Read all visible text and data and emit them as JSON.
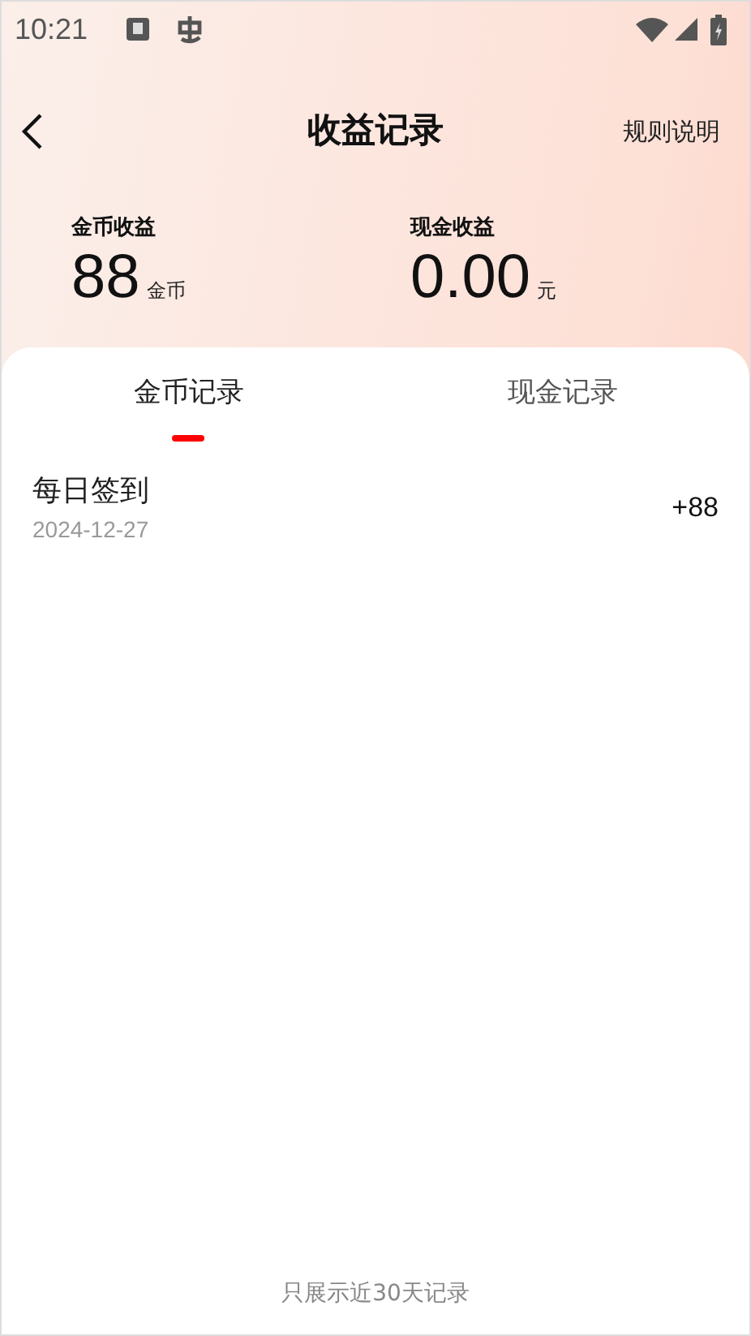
{
  "status_bar": {
    "time": "10:21"
  },
  "header": {
    "title": "收益记录",
    "action": "规则说明"
  },
  "summary": [
    {
      "label": "金币收益",
      "value": "88",
      "unit": "金币"
    },
    {
      "label": "现金收益",
      "value": "0.00",
      "unit": "元"
    }
  ],
  "tabs": [
    {
      "label": "金币记录",
      "selected": true
    },
    {
      "label": "现金记录",
      "selected": false
    }
  ],
  "records": [
    {
      "title": "每日签到",
      "date": "2024-12-27",
      "amount": "+88"
    }
  ],
  "footer": "只展示近30天记录"
}
